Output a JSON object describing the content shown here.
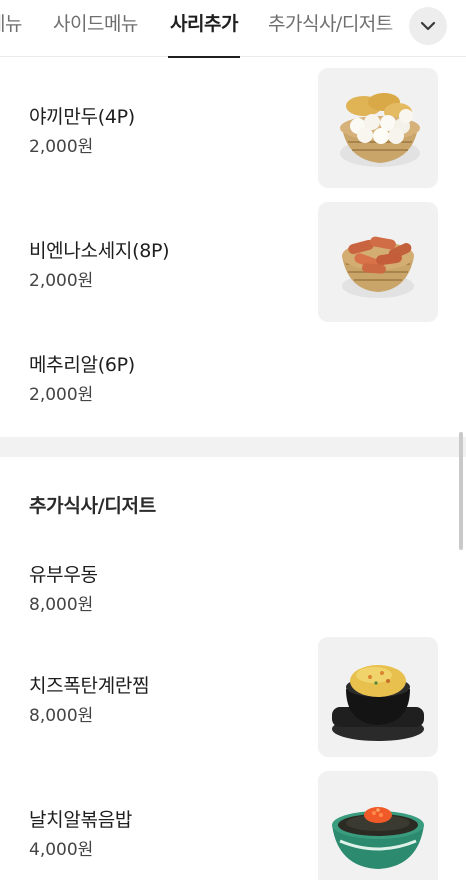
{
  "tabs": [
    {
      "label": "메뉴"
    },
    {
      "label": "사이드메뉴"
    },
    {
      "label": "사리추가"
    },
    {
      "label": "추가식사/디저트"
    }
  ],
  "items": [
    {
      "name": "야끼만두(4P)",
      "price": "2,000원",
      "image": "dumpling-basket"
    },
    {
      "name": "비엔나소세지(8P)",
      "price": "2,000원",
      "image": "sausage-basket"
    },
    {
      "name": "메추리알(6P)",
      "price": "2,000원"
    }
  ],
  "section": {
    "title": "추가식사/디저트"
  },
  "section_items": [
    {
      "name": "유부우동",
      "price": "8,000원"
    },
    {
      "name": "치즈폭탄계란찜",
      "price": "8,000원",
      "image": "steamed-egg-pot"
    },
    {
      "name": "날치알볶음밥",
      "price": "4,000원",
      "image": "roe-fried-rice-bowl"
    }
  ],
  "colors": {
    "tab_active": "#1f1f1f",
    "tab_inactive": "#6f6f6f",
    "divider": "#f2f2f2"
  },
  "icons": {
    "expand": "chevron-down-icon"
  }
}
